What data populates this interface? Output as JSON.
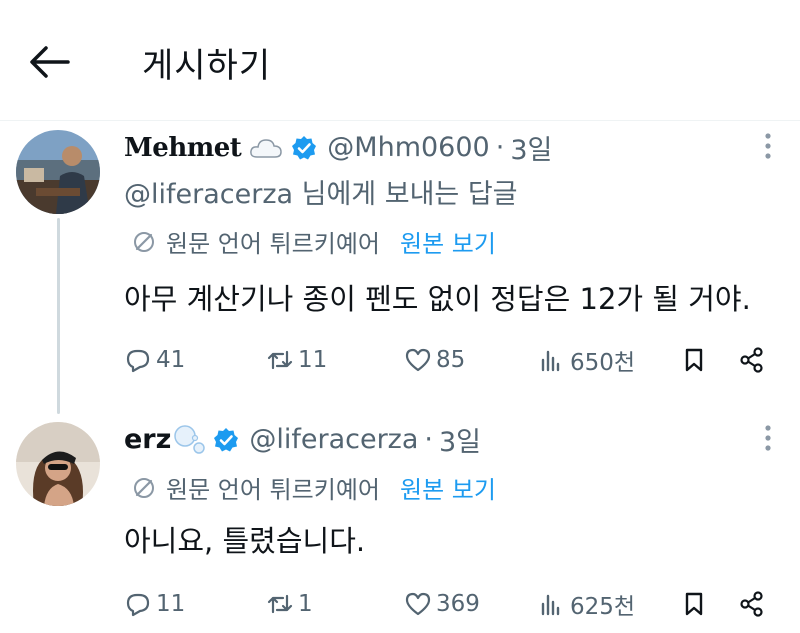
{
  "header": {
    "title": "게시하기"
  },
  "tweets": [
    {
      "display_name": "Mehmet",
      "display_emoji": "☁",
      "handle": "@Mhm0600",
      "separator": "·",
      "time": "3일",
      "reply_to_handle": "@liferacerza",
      "reply_to_suffix": " 님에게 보내는 답글",
      "translated_from": "원문 언어 튀르키예어",
      "show_original": "원본 보기",
      "text": "아무 계산기나 종이 펜도 없이 정답은 12가 될 거야.",
      "stats": {
        "replies": "41",
        "retweets": "11",
        "likes": "85",
        "views": "650천"
      }
    },
    {
      "display_name": "erz",
      "handle": "@liferacerza",
      "separator": "·",
      "time": "3일",
      "translated_from": "원문 언어 튀르키예어",
      "show_original": "원본 보기",
      "text": "아니요, 틀렸습니다.",
      "stats": {
        "replies": "11",
        "retweets": "1",
        "likes": "369",
        "views": "625천"
      }
    }
  ],
  "colors": {
    "accent": "#1d9bf0",
    "secondary_text": "#536471",
    "primary_text": "#0f1419",
    "divider": "#eff3f4"
  },
  "icons": [
    "back-arrow-icon",
    "cloud-icon",
    "verified-badge-icon",
    "bubbles-icon",
    "more-icon",
    "translate-icon",
    "reply-icon",
    "retweet-icon",
    "like-icon",
    "views-icon",
    "bookmark-icon",
    "share-icon"
  ]
}
